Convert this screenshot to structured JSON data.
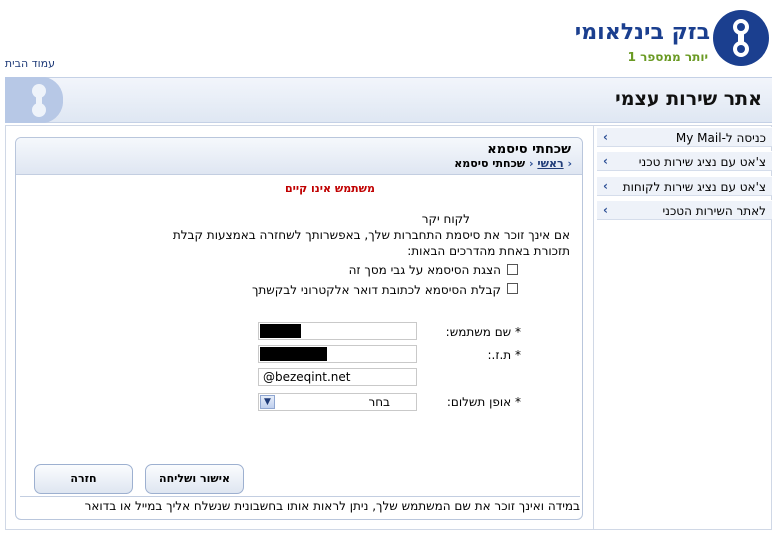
{
  "brand": {
    "name": "בזק בינלאומי",
    "tagline": "יותר ממספר 1",
    "color": "#1b3f8f",
    "accent": "#6a9a23"
  },
  "header": {
    "home_link": "עמוד הבית",
    "site_title": "אתר שירות עצמי"
  },
  "sidebar": {
    "items": [
      {
        "label": "כניסה ל-My Mail"
      },
      {
        "label": "צ'אט עם נציג שירות טכני"
      },
      {
        "label": "צ'אט עם נציג שירות לקוחות"
      },
      {
        "label": "לאתר השירות הטכני"
      }
    ]
  },
  "panel": {
    "title": "שכחתי סיסמא",
    "breadcrumb": {
      "home": "ראשי",
      "current": "שכחתי סיסמא"
    }
  },
  "error_message": "משתמש אינו קיים",
  "intro": {
    "greeting": "לקוח יקר",
    "line1": "אם אינך זוכר את סיסמת התחברות שלך, באפשרותך לשחזרה באמצעות קבלת",
    "line2": "תזכורת באחת מהדרכים הבאות:"
  },
  "options": [
    {
      "label": "הצגת הסיסמא על גבי מסך זה",
      "checked": false
    },
    {
      "label": "קבלת הסיסמא לכתובת דואר אלקטרוני לבקשתך",
      "checked": false
    }
  ],
  "form": {
    "username_label": "* שם משתמש:",
    "id_label": "* ת.ז.:",
    "email_value": "@bezeqint.net",
    "payment_label": "* אופן תשלום:",
    "payment_selected": "בחר"
  },
  "buttons": {
    "submit": "אישור ושליחה",
    "back": "חזרה"
  },
  "footer_note": "במידה ואינך זוכר את שם המשתמש שלך, ניתן לראות אותו בחשבונית שנשלח אליך במייל או בדואר"
}
